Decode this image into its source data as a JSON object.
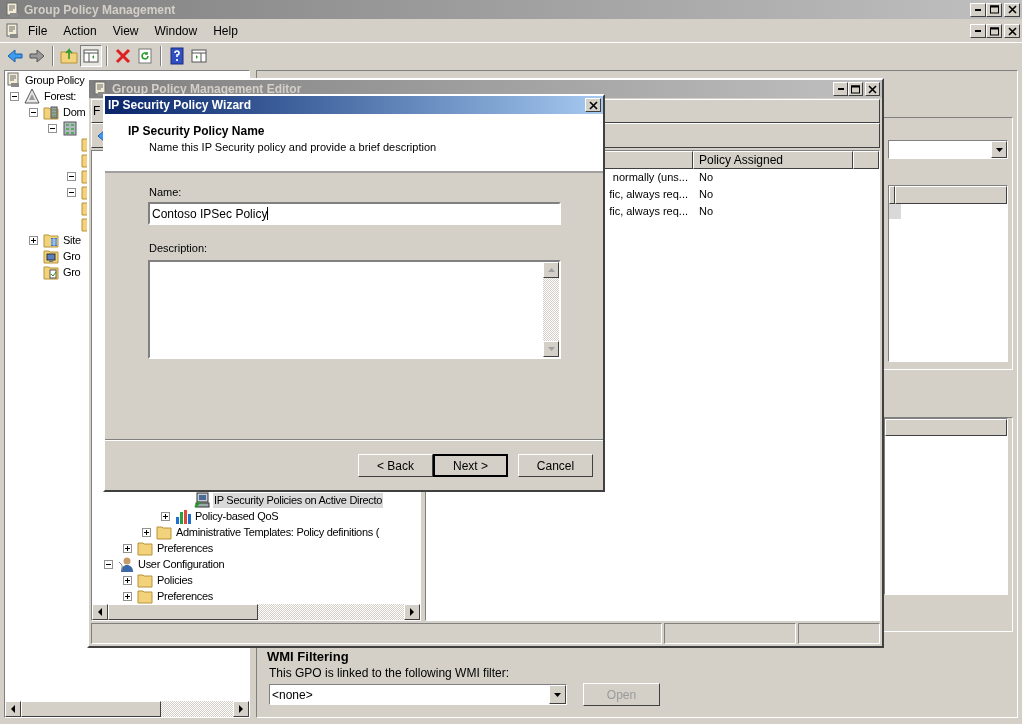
{
  "main_window": {
    "title": "Group Policy Management",
    "menu": [
      "File",
      "Action",
      "View",
      "Window",
      "Help"
    ],
    "tree": [
      {
        "label": "Group Policy",
        "kind": "console",
        "children": [
          {
            "label": "Forest:",
            "kind": "forest",
            "expanded": true,
            "children": [
              {
                "label": "Dom",
                "kind": "domains",
                "expanded": true,
                "children": [
                  {
                    "kind": "domain",
                    "expanded": true,
                    "children": [
                      {
                        "kind": "folder"
                      },
                      {
                        "kind": "folder"
                      },
                      {
                        "kind": "folder",
                        "expanded": true
                      },
                      {
                        "kind": "folder",
                        "expanded": true
                      },
                      {
                        "kind": "folder"
                      },
                      {
                        "kind": "folder"
                      }
                    ]
                  }
                ]
              },
              {
                "label": "Site",
                "kind": "sites",
                "expanded": false
              },
              {
                "label": "Gro",
                "kind": "modeling"
              },
              {
                "label": "Gro",
                "kind": "results"
              }
            ]
          }
        ]
      }
    ],
    "wmi": {
      "heading": "WMI Filtering",
      "text": "This GPO is linked to the following WMI filter:",
      "filter": "<none>",
      "open_button": {
        "label": "Open",
        "disabled": true
      }
    }
  },
  "editor_window": {
    "title": "Group Policy Management Editor",
    "menu": [
      "F"
    ],
    "tree": [
      {
        "children": [
          {
            "children": [
              {
                "children": [
                  {
                    "children": [
                      {
                        "label": "IP Security Policies on Active Directo",
                        "kind": "ipsec",
                        "selected": true
                      }
                    ]
                  },
                  {
                    "label": "Policy-based QoS",
                    "kind": "qos",
                    "expanded": false,
                    "selected": false
                  }
                ]
              },
              {
                "label": "Administrative Templates: Policy definitions (",
                "kind": "folder",
                "expanded": false,
                "selected": false
              }
            ]
          },
          {
            "label": "Preferences",
            "kind": "folder",
            "expanded": false,
            "selected": false
          }
        ]
      },
      {
        "label": "User Configuration",
        "kind": "user",
        "expanded": true,
        "selected": false,
        "children": [
          {
            "label": "Policies",
            "kind": "folder",
            "expanded": false,
            "selected": false
          },
          {
            "label": "Preferences",
            "kind": "folder",
            "expanded": false,
            "selected": false
          }
        ]
      }
    ],
    "columns": [
      "Policy Assigned"
    ],
    "rows": [
      {
        "column_1": "normally (uns...",
        "policy_assigned": "No"
      },
      {
        "column_1": "fic, always req...",
        "policy_assigned": "No"
      },
      {
        "column_1": "fic, always req...",
        "policy_assigned": "No"
      }
    ]
  },
  "wizard": {
    "title": "IP Security Policy Wizard",
    "heading": "IP Security Policy Name",
    "subtitle": "Name this IP Security policy and provide a brief description",
    "name_label": "Name:",
    "name_value": "Contoso IPSec Policy",
    "description_label": "Description:",
    "buttons": [
      {
        "label": "< Back",
        "default": false
      },
      {
        "label": "Next >",
        "default": true
      },
      {
        "label": "Cancel",
        "default": false
      }
    ]
  }
}
